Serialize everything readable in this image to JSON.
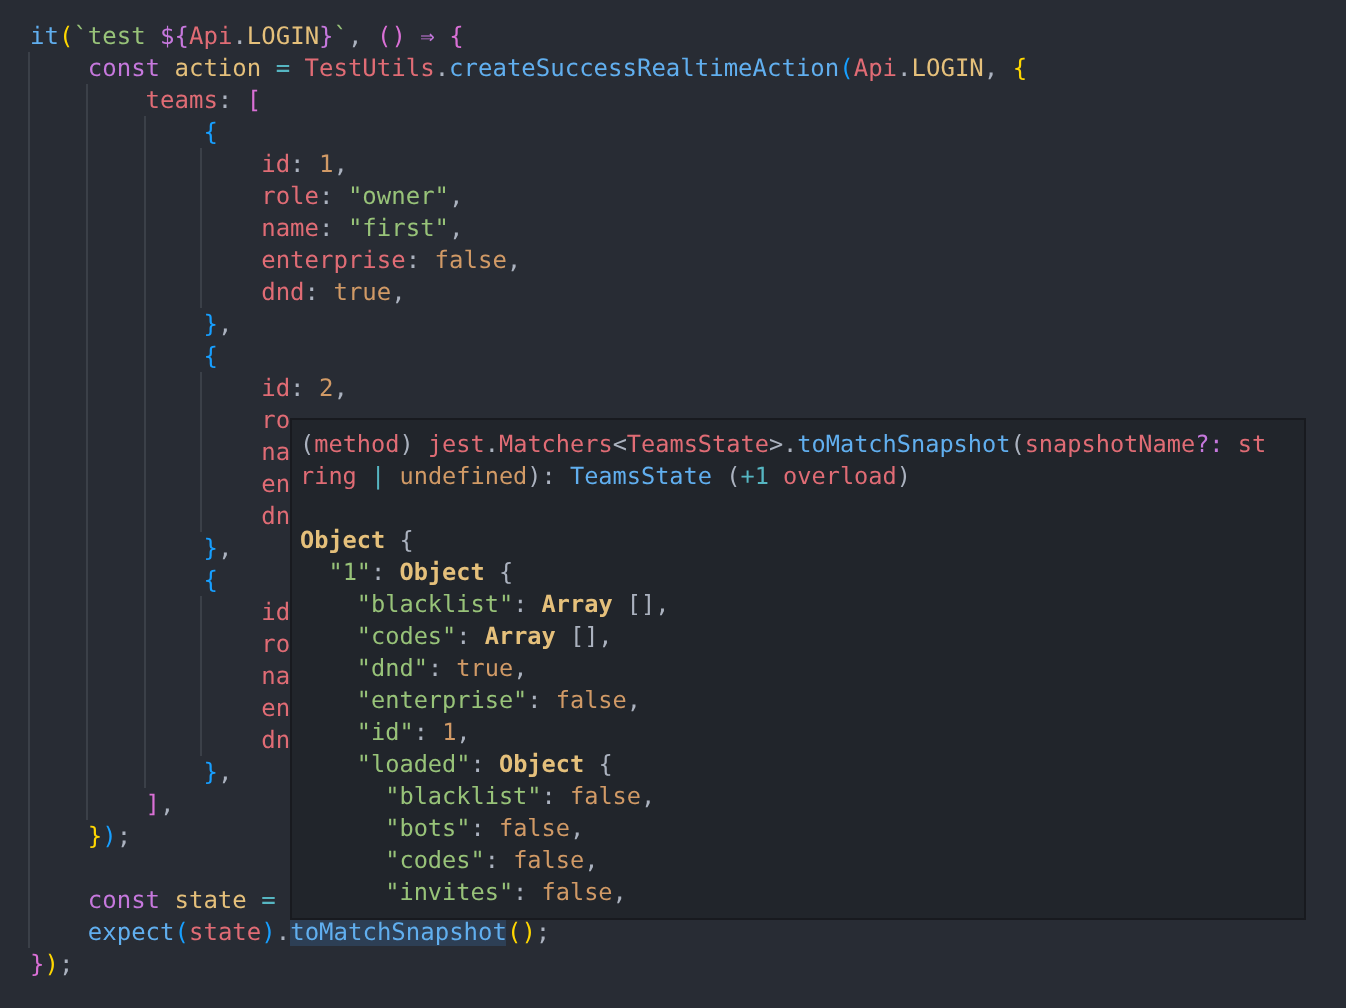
{
  "editor": {
    "lines": [
      {
        "tokens": [
          {
            "t": "it",
            "kind": "fn"
          },
          {
            "t": "(",
            "kind": "b1"
          },
          {
            "t": "`test ",
            "kind": "str"
          },
          {
            "t": "${",
            "kind": "kw"
          },
          {
            "t": "Api",
            "kind": "prop"
          },
          {
            "t": ".",
            "kind": "p"
          },
          {
            "t": "LOGIN",
            "kind": "const"
          },
          {
            "t": "}",
            "kind": "kw"
          },
          {
            "t": "`",
            "kind": "str"
          },
          {
            "t": ", ",
            "kind": "p"
          },
          {
            "t": "() ",
            "kind": "b2"
          },
          {
            "t": "⇒ ",
            "kind": "kw"
          },
          {
            "t": "{",
            "kind": "b2"
          }
        ]
      },
      {
        "tokens": [
          {
            "t": "    const",
            "kind": "kw"
          },
          {
            "t": " action ",
            "kind": "const"
          },
          {
            "t": "=",
            "kind": "op"
          },
          {
            "t": " TestUtils",
            "kind": "prop"
          },
          {
            "t": ".",
            "kind": "p"
          },
          {
            "t": "createSuccessRealtimeAction",
            "kind": "fn"
          },
          {
            "t": "(",
            "kind": "b3"
          },
          {
            "t": "Api",
            "kind": "prop"
          },
          {
            "t": ".",
            "kind": "p"
          },
          {
            "t": "LOGIN",
            "kind": "const"
          },
          {
            "t": ", ",
            "kind": "p"
          },
          {
            "t": "{",
            "kind": "b1"
          }
        ]
      },
      {
        "tokens": [
          {
            "t": "        teams",
            "kind": "prop"
          },
          {
            "t": ": ",
            "kind": "p"
          },
          {
            "t": "[",
            "kind": "b2"
          }
        ]
      },
      {
        "tokens": [
          {
            "t": "            {",
            "kind": "b3"
          }
        ]
      },
      {
        "tokens": [
          {
            "t": "                id",
            "kind": "prop"
          },
          {
            "t": ": ",
            "kind": "p"
          },
          {
            "t": "1",
            "kind": "num"
          },
          {
            "t": ",",
            "kind": "p"
          }
        ]
      },
      {
        "tokens": [
          {
            "t": "                role",
            "kind": "prop"
          },
          {
            "t": ": ",
            "kind": "p"
          },
          {
            "t": "\"owner\"",
            "kind": "str"
          },
          {
            "t": ",",
            "kind": "p"
          }
        ]
      },
      {
        "tokens": [
          {
            "t": "                name",
            "kind": "prop"
          },
          {
            "t": ": ",
            "kind": "p"
          },
          {
            "t": "\"first\"",
            "kind": "str"
          },
          {
            "t": ",",
            "kind": "p"
          }
        ]
      },
      {
        "tokens": [
          {
            "t": "                enterprise",
            "kind": "prop"
          },
          {
            "t": ": ",
            "kind": "p"
          },
          {
            "t": "false",
            "kind": "num"
          },
          {
            "t": ",",
            "kind": "p"
          }
        ]
      },
      {
        "tokens": [
          {
            "t": "                dnd",
            "kind": "prop"
          },
          {
            "t": ": ",
            "kind": "p"
          },
          {
            "t": "true",
            "kind": "num"
          },
          {
            "t": ",",
            "kind": "p"
          }
        ]
      },
      {
        "tokens": [
          {
            "t": "            }",
            "kind": "b3"
          },
          {
            "t": ",",
            "kind": "p"
          }
        ]
      },
      {
        "tokens": [
          {
            "t": "            {",
            "kind": "b3"
          }
        ]
      },
      {
        "tokens": [
          {
            "t": "                id",
            "kind": "prop"
          },
          {
            "t": ": ",
            "kind": "p"
          },
          {
            "t": "2",
            "kind": "num"
          },
          {
            "t": ",",
            "kind": "p"
          }
        ]
      },
      {
        "tokens": [
          {
            "t": "                ro",
            "kind": "prop"
          }
        ]
      },
      {
        "tokens": [
          {
            "t": "                na",
            "kind": "prop"
          }
        ]
      },
      {
        "tokens": [
          {
            "t": "                en",
            "kind": "prop"
          }
        ]
      },
      {
        "tokens": [
          {
            "t": "                dn",
            "kind": "prop"
          }
        ]
      },
      {
        "tokens": [
          {
            "t": "            }",
            "kind": "b3"
          },
          {
            "t": ",",
            "kind": "p"
          }
        ]
      },
      {
        "tokens": [
          {
            "t": "            {",
            "kind": "b3"
          }
        ]
      },
      {
        "tokens": [
          {
            "t": "                id",
            "kind": "prop"
          }
        ]
      },
      {
        "tokens": [
          {
            "t": "                ro",
            "kind": "prop"
          }
        ]
      },
      {
        "tokens": [
          {
            "t": "                na",
            "kind": "prop"
          }
        ]
      },
      {
        "tokens": [
          {
            "t": "                en",
            "kind": "prop"
          }
        ]
      },
      {
        "tokens": [
          {
            "t": "                dn",
            "kind": "prop"
          }
        ]
      },
      {
        "tokens": [
          {
            "t": "            }",
            "kind": "b3"
          },
          {
            "t": ",",
            "kind": "p"
          }
        ]
      },
      {
        "tokens": [
          {
            "t": "        ]",
            "kind": "b2"
          },
          {
            "t": ",",
            "kind": "p"
          }
        ]
      },
      {
        "tokens": [
          {
            "t": "    }",
            "kind": "b1"
          },
          {
            "t": ")",
            "kind": "b3"
          },
          {
            "t": ";",
            "kind": "p"
          }
        ]
      },
      {
        "blank_before": true,
        "tokens": [
          {
            "t": "    const",
            "kind": "kw"
          },
          {
            "t": " state ",
            "kind": "const"
          },
          {
            "t": "=",
            "kind": "op"
          }
        ]
      },
      {
        "tokens": [
          {
            "t": "    expect",
            "kind": "fn"
          },
          {
            "t": "(",
            "kind": "b3"
          },
          {
            "t": "state",
            "kind": "prop"
          },
          {
            "t": ")",
            "kind": "b3"
          },
          {
            "t": ".",
            "kind": "p"
          },
          {
            "t": "toMatchSnapshot",
            "kind": "fn",
            "hovered": true
          },
          {
            "t": "()",
            "kind": "b1"
          },
          {
            "t": ";",
            "kind": "p"
          }
        ]
      },
      {
        "tokens": [
          {
            "t": "}",
            "kind": "b2"
          },
          {
            "t": ")",
            "kind": "b1"
          },
          {
            "t": ";",
            "kind": "p"
          }
        ]
      }
    ]
  },
  "tooltip": {
    "lines": [
      {
        "tokens": [
          {
            "t": "(",
            "kind": "p"
          },
          {
            "t": "method",
            "kind": "prop"
          },
          {
            "t": ") ",
            "kind": "p"
          },
          {
            "t": "jest",
            "kind": "prop"
          },
          {
            "t": ".",
            "kind": "p"
          },
          {
            "t": "Matchers",
            "kind": "prop"
          },
          {
            "t": "<",
            "kind": "p"
          },
          {
            "t": "TeamsState",
            "kind": "prop"
          },
          {
            "t": ">.",
            "kind": "p"
          },
          {
            "t": "toMatchSnapshot",
            "kind": "fn"
          },
          {
            "t": "(",
            "kind": "p"
          },
          {
            "t": "snapshotName",
            "kind": "prop"
          },
          {
            "t": "?:",
            "kind": "kw"
          },
          {
            "t": " st",
            "kind": "prop"
          }
        ]
      },
      {
        "tokens": [
          {
            "t": "ring",
            "kind": "prop"
          },
          {
            "t": " | ",
            "kind": "op"
          },
          {
            "t": "undefined",
            "kind": "num"
          },
          {
            "t": "): ",
            "kind": "p"
          },
          {
            "t": "TeamsState",
            "kind": "fn"
          },
          {
            "t": " (",
            "kind": "p"
          },
          {
            "t": "+1",
            "kind": "op"
          },
          {
            "t": " overload",
            "kind": "prop"
          },
          {
            "t": ")",
            "kind": "p"
          }
        ]
      },
      {
        "blank_before": true,
        "tokens": [
          {
            "t": "Object",
            "kind": "type"
          },
          {
            "t": " {",
            "kind": "p"
          }
        ]
      },
      {
        "tokens": [
          {
            "t": "  \"1\"",
            "kind": "str"
          },
          {
            "t": ": ",
            "kind": "p"
          },
          {
            "t": "Object",
            "kind": "type"
          },
          {
            "t": " {",
            "kind": "p"
          }
        ]
      },
      {
        "tokens": [
          {
            "t": "    \"blacklist\"",
            "kind": "str"
          },
          {
            "t": ": ",
            "kind": "p"
          },
          {
            "t": "Array",
            "kind": "type"
          },
          {
            "t": " [],",
            "kind": "p"
          }
        ]
      },
      {
        "tokens": [
          {
            "t": "    \"codes\"",
            "kind": "str"
          },
          {
            "t": ": ",
            "kind": "p"
          },
          {
            "t": "Array",
            "kind": "type"
          },
          {
            "t": " [],",
            "kind": "p"
          }
        ]
      },
      {
        "tokens": [
          {
            "t": "    \"dnd\"",
            "kind": "str"
          },
          {
            "t": ": ",
            "kind": "p"
          },
          {
            "t": "true",
            "kind": "num"
          },
          {
            "t": ",",
            "kind": "p"
          }
        ]
      },
      {
        "tokens": [
          {
            "t": "    \"enterprise\"",
            "kind": "str"
          },
          {
            "t": ": ",
            "kind": "p"
          },
          {
            "t": "false",
            "kind": "num"
          },
          {
            "t": ",",
            "kind": "p"
          }
        ]
      },
      {
        "tokens": [
          {
            "t": "    \"id\"",
            "kind": "str"
          },
          {
            "t": ": ",
            "kind": "p"
          },
          {
            "t": "1",
            "kind": "num"
          },
          {
            "t": ",",
            "kind": "p"
          }
        ]
      },
      {
        "tokens": [
          {
            "t": "    \"loaded\"",
            "kind": "str"
          },
          {
            "t": ": ",
            "kind": "p"
          },
          {
            "t": "Object",
            "kind": "type"
          },
          {
            "t": " {",
            "kind": "p"
          }
        ]
      },
      {
        "tokens": [
          {
            "t": "      \"blacklist\"",
            "kind": "str"
          },
          {
            "t": ": ",
            "kind": "p"
          },
          {
            "t": "false",
            "kind": "num"
          },
          {
            "t": ",",
            "kind": "p"
          }
        ]
      },
      {
        "tokens": [
          {
            "t": "      \"bots\"",
            "kind": "str"
          },
          {
            "t": ": ",
            "kind": "p"
          },
          {
            "t": "false",
            "kind": "num"
          },
          {
            "t": ",",
            "kind": "p"
          }
        ]
      },
      {
        "tokens": [
          {
            "t": "      \"codes\"",
            "kind": "str"
          },
          {
            "t": ": ",
            "kind": "p"
          },
          {
            "t": "false",
            "kind": "num"
          },
          {
            "t": ",",
            "kind": "p"
          }
        ]
      },
      {
        "tokens": [
          {
            "t": "      \"invites\"",
            "kind": "str"
          },
          {
            "t": ": ",
            "kind": "p"
          },
          {
            "t": "false",
            "kind": "num"
          },
          {
            "t": ",",
            "kind": "p"
          }
        ]
      }
    ]
  }
}
